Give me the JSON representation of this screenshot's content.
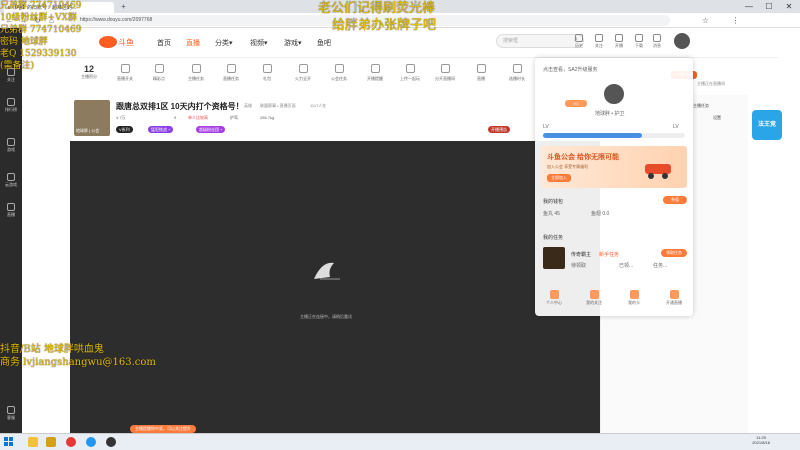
{
  "browser": {
    "tab_title": "ʙ 【哈】的旧账号：超难区的...",
    "url": "https://www.douyu.com/2097768",
    "new_tab": "+",
    "win_min": "—",
    "win_max": "☐",
    "win_close": "✕"
  },
  "overlays": {
    "left_lines": [
      "兄弟群 774710469",
      "10级粉丝群+VX群",
      "兄弟群 774710469",
      "密码 地球胖",
      "老Q 1529339130",
      "(需备注)"
    ],
    "top_right_lines": [
      "老公们记得刷荧光棒",
      "给胖弟办张牌子吧"
    ],
    "bottom_lines": [
      "抖音/B站 地球胖哄血鬼",
      "商务 lvjiangshangwu@163.com"
    ]
  },
  "sidebar": {
    "items": [
      {
        "label": "关注",
        "icon": "heart-icon"
      },
      {
        "label": "排行榜",
        "icon": "rank-icon"
      },
      {
        "label": "游戏",
        "icon": "gamepad-icon"
      },
      {
        "label": "云游戏",
        "icon": "cloud-icon"
      },
      {
        "label": "直播",
        "icon": "live-icon"
      },
      {
        "label": "客服",
        "icon": "service-icon"
      }
    ]
  },
  "header": {
    "logo": "斗鱼",
    "nav": [
      {
        "label": "首页",
        "active": false
      },
      {
        "label": "直播",
        "active": true
      },
      {
        "label": "分类▾",
        "active": false
      },
      {
        "label": "视频▾",
        "active": false
      },
      {
        "label": "游戏▾",
        "active": false
      },
      {
        "label": "鱼吧",
        "active": false
      }
    ],
    "search_placeholder": "搜索框",
    "icons": [
      {
        "label": "历史",
        "icon": "history-icon"
      },
      {
        "label": "关注",
        "icon": "follow-icon"
      },
      {
        "label": "开播",
        "icon": "broadcast-icon"
      },
      {
        "label": "下载",
        "icon": "download-icon"
      },
      {
        "label": "消息",
        "icon": "message-icon"
      }
    ]
  },
  "toolbar": {
    "level_number": "12",
    "level_label": "主播积分",
    "items": [
      "直播开关",
      "精彩点",
      "主播任务",
      "直播任务",
      "礼包",
      "火力全开",
      "公会任务",
      "开播提醒",
      "上传一起玩",
      "分开直播间",
      "直播",
      "选播时长"
    ]
  },
  "room": {
    "title": "跟唐总双排1区 10天内打个资格号！",
    "category": "英雄",
    "sub": "联盟赛事 • 直播页面",
    "count": "1117人在",
    "avatar_label": "地球胖 | 公会",
    "stats": [
      "4.7万",
      "9",
      "单人比较高",
      "护驾",
      "286.7kg"
    ],
    "tags": [
      "V系列",
      "猛犯挑战 +",
      "超级粉丝团 +"
    ],
    "right_tag": "开播预告"
  },
  "player": {
    "loading_text": "主播正在连接中，请稍后重试"
  },
  "right_panel": {
    "tabs": [
      "PC客户端",
      "主播任务",
      "设置"
    ],
    "tip": "主播正在直播间"
  },
  "dropdown": {
    "username": "地球胖 • 护卫",
    "vip_label": "V1",
    "level_from": "LV",
    "level_to": "LV",
    "progress": 0.7,
    "header_text": "点击查看，SA2升级服务",
    "promo_title": "斗鱼公会 给你无限可能",
    "promo_sub": "加入公会 享受专属福利",
    "promo_button": "立即加入",
    "wallet_title": "我的钱包",
    "wallet_balance": "鱼丸 45",
    "wallet_coins": "鱼翅 0.0",
    "wallet_button": "充值",
    "task_title": "我的任务",
    "task_name": "传奇霸主",
    "task_tag": "新手任务",
    "task_items": [
      "待领取",
      "已领...",
      "任务..."
    ],
    "task_button": "领取任务",
    "bottom_items": [
      {
        "label": "个人中心",
        "icon": "user-icon"
      },
      {
        "label": "我的关注",
        "icon": "heart-icon"
      },
      {
        "label": "我的卡",
        "icon": "card-icon"
      },
      {
        "label": "开通直播",
        "icon": "camera-icon"
      }
    ]
  },
  "ad_badge": "法王竞",
  "bottom_pill": "主播提醒你中奖，可以关注提升",
  "taskbar": {
    "time": "11:29",
    "date": "2021/8/16"
  }
}
